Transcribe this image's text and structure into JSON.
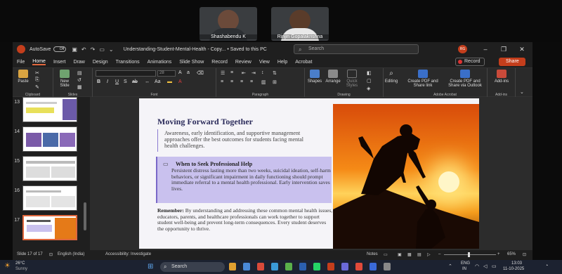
{
  "meeting": {
    "participants": [
      {
        "name": "Shashabendu K"
      },
      {
        "name": "Rinjin Gopalakrishna"
      }
    ]
  },
  "window": {
    "autosave_label": "AutoSave",
    "autosave_state": "Off",
    "doc_title": "Understanding-Student-Mental-Health - Copy... • Saved to this PC",
    "search_placeholder": "Search",
    "user_initials": "RG"
  },
  "menu": {
    "items": [
      "File",
      "Home",
      "Insert",
      "Draw",
      "Design",
      "Transitions",
      "Animations",
      "Slide Show",
      "Record",
      "Review",
      "View",
      "Help",
      "Acrobat"
    ],
    "active": "Home",
    "record_label": "Record",
    "share_label": "Share"
  },
  "ribbon": {
    "groups": [
      "Clipboard",
      "Slides",
      "Font",
      "Paragraph",
      "Drawing",
      "Adobe Acrobat",
      "Add-ins"
    ],
    "paste": "Paste",
    "new_slide": "New Slide",
    "font_size": "28",
    "shapes": "Shapes",
    "arrange": "Arrange",
    "quick_styles": "Quick Styles",
    "editing": "Editing",
    "create_pdf_share": "Create PDF and Share link",
    "create_pdf_outlook": "Create PDF and Share via Outlook",
    "addins": "Add-ins"
  },
  "thumbnails": [
    {
      "num": "13"
    },
    {
      "num": "14"
    },
    {
      "num": "15"
    },
    {
      "num": "16"
    },
    {
      "num": "17",
      "selected": true
    }
  ],
  "slide": {
    "title": "Moving Forward Together",
    "subtitle": "Awareness, early identification, and supportive management approaches offer the best outcomes for students facing mental health challenges.",
    "callout_title": "When to Seek Professional Help",
    "callout_body": "Persistent distress lasting more than two weeks, suicidal ideation, self-harm behaviors, or significant impairment in daily functioning should prompt immediate referral to a mental health professional. Early intervention saves lives.",
    "remember_label": "Remember:",
    "remember_body": " By understanding and addressing these common mental health issues, educators, parents, and healthcare professionals can work together to support student well-being and prevent long-term consequences. Every student deserves the opportunity to thrive."
  },
  "status": {
    "slide_count": "Slide 17 of 17",
    "language": "English (India)",
    "accessibility": "Accessibility: Investigate",
    "notes": "Notes",
    "zoom": "65%"
  },
  "taskbar": {
    "weather_temp": "26°C",
    "weather_desc": "Sunny",
    "search": "Search",
    "lang1": "ENG",
    "lang2": "IN",
    "time": "13:03",
    "date": "11-10-2025"
  },
  "colors": {
    "accent": "#c43e1c",
    "slide_title": "#2a2a5a",
    "callout_bg": "#c9c1ee"
  }
}
